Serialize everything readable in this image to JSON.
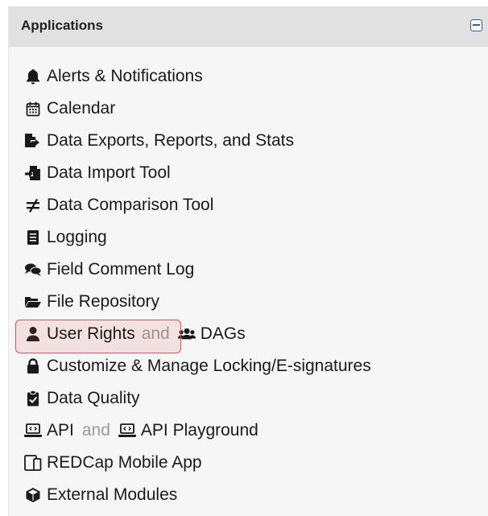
{
  "panel": {
    "title": "Applications"
  },
  "items": [
    {
      "label": "Alerts & Notifications",
      "icon": "bell-icon"
    },
    {
      "label": "Calendar",
      "icon": "calendar-icon"
    },
    {
      "label": "Data Exports, Reports, and Stats",
      "icon": "file-export-icon"
    },
    {
      "label": "Data Import Tool",
      "icon": "file-import-icon"
    },
    {
      "label": "Data Comparison Tool",
      "icon": "not-equal-icon"
    },
    {
      "label": "Logging",
      "icon": "list-document-icon"
    },
    {
      "label": "Field Comment Log",
      "icon": "comments-icon"
    },
    {
      "label": "File Repository",
      "icon": "folder-open-icon"
    },
    {
      "label": "User Rights",
      "icon": "user-icon",
      "and": "and",
      "second_label": "DAGs",
      "second_icon": "users-icon"
    },
    {
      "label": "Customize & Manage Locking/E-signatures",
      "icon": "lock-icon"
    },
    {
      "label": "Data Quality",
      "icon": "clipboard-check-icon"
    },
    {
      "label": "API",
      "icon": "laptop-code-icon",
      "and": "and",
      "second_label": "API Playground",
      "second_icon": "laptop-code-icon"
    },
    {
      "label": "REDCap Mobile App",
      "icon": "tablet-icon"
    },
    {
      "label": "External Modules",
      "icon": "cube-icon"
    }
  ],
  "highlight_color": "#d9534f",
  "accent_color": "#3a5a99"
}
